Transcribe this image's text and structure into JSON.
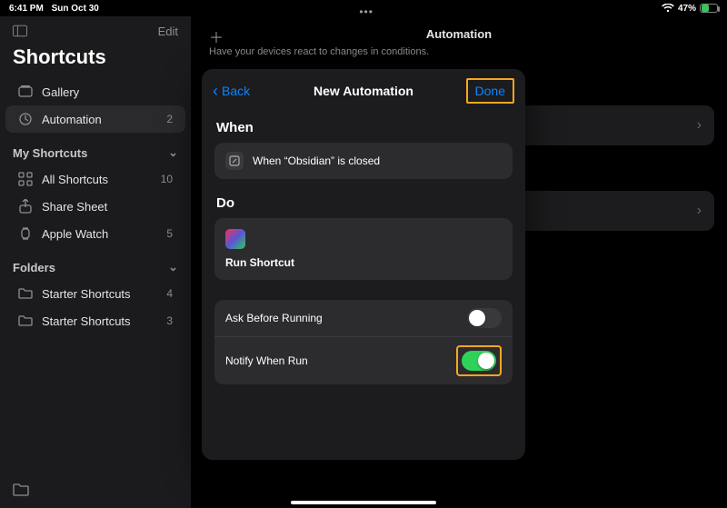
{
  "status": {
    "time": "6:41 PM",
    "date": "Sun Oct 30",
    "battery_pct": "47%",
    "battery_fill_pct": 47
  },
  "sidebar": {
    "edit": "Edit",
    "title": "Shortcuts",
    "items": [
      {
        "label": "Gallery"
      },
      {
        "label": "Automation",
        "count": "2",
        "selected": true
      }
    ],
    "my_header": "My Shortcuts",
    "my_items": [
      {
        "label": "All Shortcuts",
        "count": "10"
      },
      {
        "label": "Share Sheet"
      },
      {
        "label": "Apple Watch",
        "count": "5"
      }
    ],
    "folders_header": "Folders",
    "folders": [
      {
        "label": "Starter Shortcuts",
        "count": "4"
      },
      {
        "label": "Starter Shortcuts",
        "count": "3"
      }
    ]
  },
  "main": {
    "title": "Automation",
    "subtitle": "Have your devices react to changes in conditions."
  },
  "modal": {
    "back": "Back",
    "title": "New Automation",
    "done": "Done",
    "when_header": "When",
    "when_text": "When “Obsidian” is closed",
    "do_header": "Do",
    "do_action": "Run Shortcut",
    "settings": [
      {
        "label": "Ask Before Running",
        "on": false
      },
      {
        "label": "Notify When Run",
        "on": true
      }
    ]
  }
}
